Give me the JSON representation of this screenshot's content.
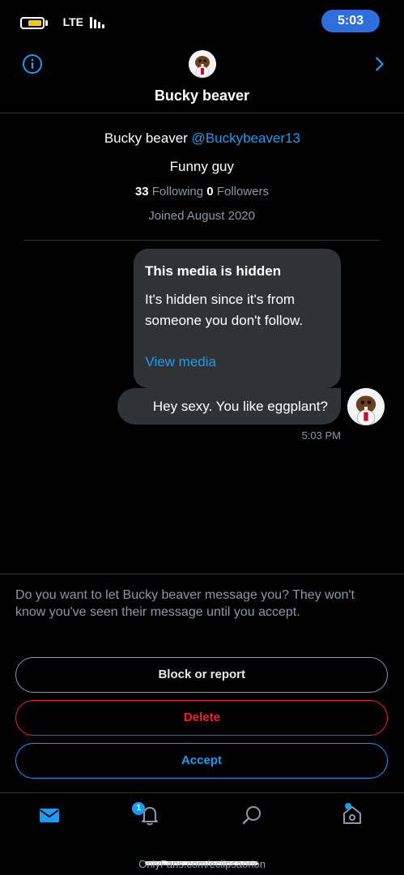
{
  "status_bar": {
    "time": "5:03",
    "network": "LTE"
  },
  "header": {
    "title": "Bucky beaver"
  },
  "profile": {
    "name": "Bucky beaver",
    "handle": "@Buckybeaver13",
    "bio": "Funny guy",
    "following_count": "33",
    "following_label": "Following",
    "followers_count": "0",
    "followers_label": "Followers",
    "joined": "Joined August 2020"
  },
  "message": {
    "media_title": "This media is hidden",
    "media_text": "It's hidden since it's from someone you don't follow.",
    "media_link": "View media",
    "text": "Hey sexy. You like eggplant?",
    "time": "5:03 PM"
  },
  "request": {
    "prompt": "Do you want to let Bucky beaver message you? They won't know you've seen their message until you accept.",
    "block_label": "Block or report",
    "delete_label": "Delete",
    "accept_label": "Accept"
  },
  "tabbar": {
    "items": [
      {
        "icon": "home-icon"
      },
      {
        "icon": "search-icon"
      },
      {
        "icon": "bell-icon",
        "badge": "1"
      },
      {
        "icon": "mail-icon",
        "active": true
      }
    ]
  },
  "watermark": "OnlyFans.com/eclipsaorion",
  "colors": {
    "accent": "#1d9bf0",
    "danger": "#f4212e",
    "bubble": "#2f3336",
    "background": "#000000"
  }
}
